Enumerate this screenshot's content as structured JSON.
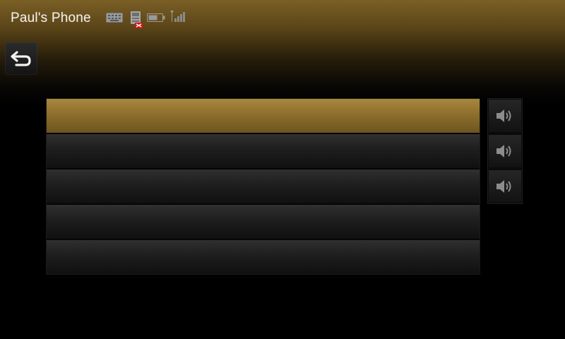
{
  "header": {
    "device_name": "Paul's Phone",
    "status_icons": [
      "keyboard-icon",
      "phonebook-icon",
      "battery-icon",
      "signal-icon"
    ]
  },
  "nav": {
    "back_icon": "back-arrow-icon"
  },
  "list": {
    "selected_index": 0,
    "items": [
      {
        "label": ""
      },
      {
        "label": ""
      },
      {
        "label": ""
      },
      {
        "label": ""
      },
      {
        "label": ""
      }
    ]
  },
  "audio_buttons": [
    {
      "icon": "speaker-icon"
    },
    {
      "icon": "speaker-icon"
    },
    {
      "icon": "speaker-icon"
    }
  ],
  "colors": {
    "accent": "#8e6f2c",
    "background": "#000000",
    "text": "#f0eee8"
  }
}
